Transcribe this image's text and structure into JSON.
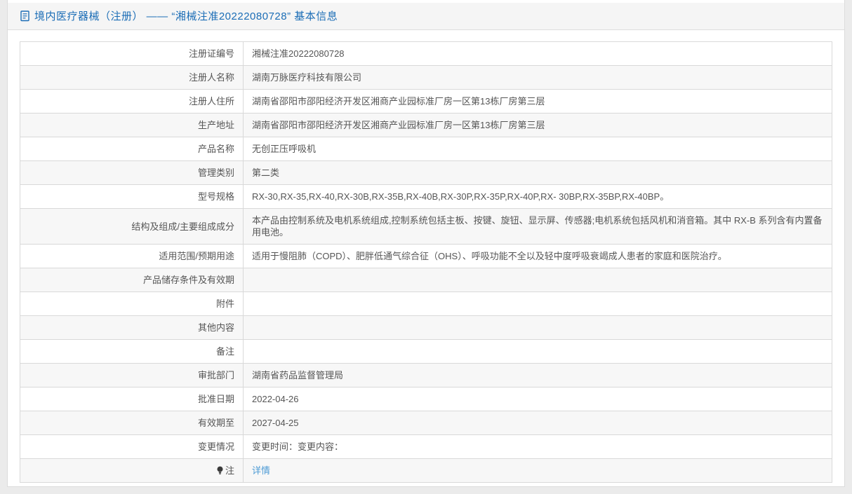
{
  "header": {
    "title": "境内医疗器械（注册） —— “湘械注准20222080728” 基本信息",
    "doc_icon": "document-icon"
  },
  "colors": {
    "page_background": "#ebebeb",
    "panel_background": "#ffffff",
    "title_bar_background": "#f5f5f5",
    "title_text": "#1b6db6",
    "table_border": "#d9d9d9",
    "alt_row_background": "#f7f7f7",
    "body_text": "#555555",
    "link_text": "#4d9bd5"
  },
  "table": {
    "rows": [
      {
        "label": "注册证编号",
        "value": "湘械注准20222080728"
      },
      {
        "label": "注册人名称",
        "value": "湖南万脉医疗科技有限公司"
      },
      {
        "label": "注册人住所",
        "value": "湖南省邵阳市邵阳经济开发区湘商产业园标准厂房一区第13栋厂房第三层"
      },
      {
        "label": "生产地址",
        "value": "湖南省邵阳市邵阳经济开发区湘商产业园标准厂房一区第13栋厂房第三层"
      },
      {
        "label": "产品名称",
        "value": "无创正压呼吸机"
      },
      {
        "label": "管理类别",
        "value": "第二类"
      },
      {
        "label": "型号规格",
        "value": "RX-30,RX-35,RX-40,RX-30B,RX-35B,RX-40B,RX-30P,RX-35P,RX-40P,RX- 30BP,RX-35BP,RX-40BP。"
      },
      {
        "label": "结构及组成/主要组成成分",
        "value": "本产品由控制系统及电机系统组成,控制系统包括主板、按键、旋钮、显示屏、传感器;电机系统包括风机和消音箱。其中 RX-B 系列含有内置备用电池。"
      },
      {
        "label": "适用范围/预期用途",
        "value": "适用于慢阻肺（COPD）、肥胖低通气综合征（OHS）、呼吸功能不全以及轻中度呼吸衰竭成人患者的家庭和医院治疗。"
      },
      {
        "label": "产品储存条件及有效期",
        "value": ""
      },
      {
        "label": "附件",
        "value": ""
      },
      {
        "label": "其他内容",
        "value": ""
      },
      {
        "label": "备注",
        "value": ""
      },
      {
        "label": "审批部门",
        "value": "湖南省药品监督管理局"
      },
      {
        "label": "批准日期",
        "value": "2022-04-26"
      },
      {
        "label": "有效期至",
        "value": "2027-04-25"
      },
      {
        "label": "变更情况",
        "value": "变更时间：变更内容："
      },
      {
        "label": "注",
        "link_label": "详情",
        "icon": "lightbulb-icon"
      }
    ]
  }
}
